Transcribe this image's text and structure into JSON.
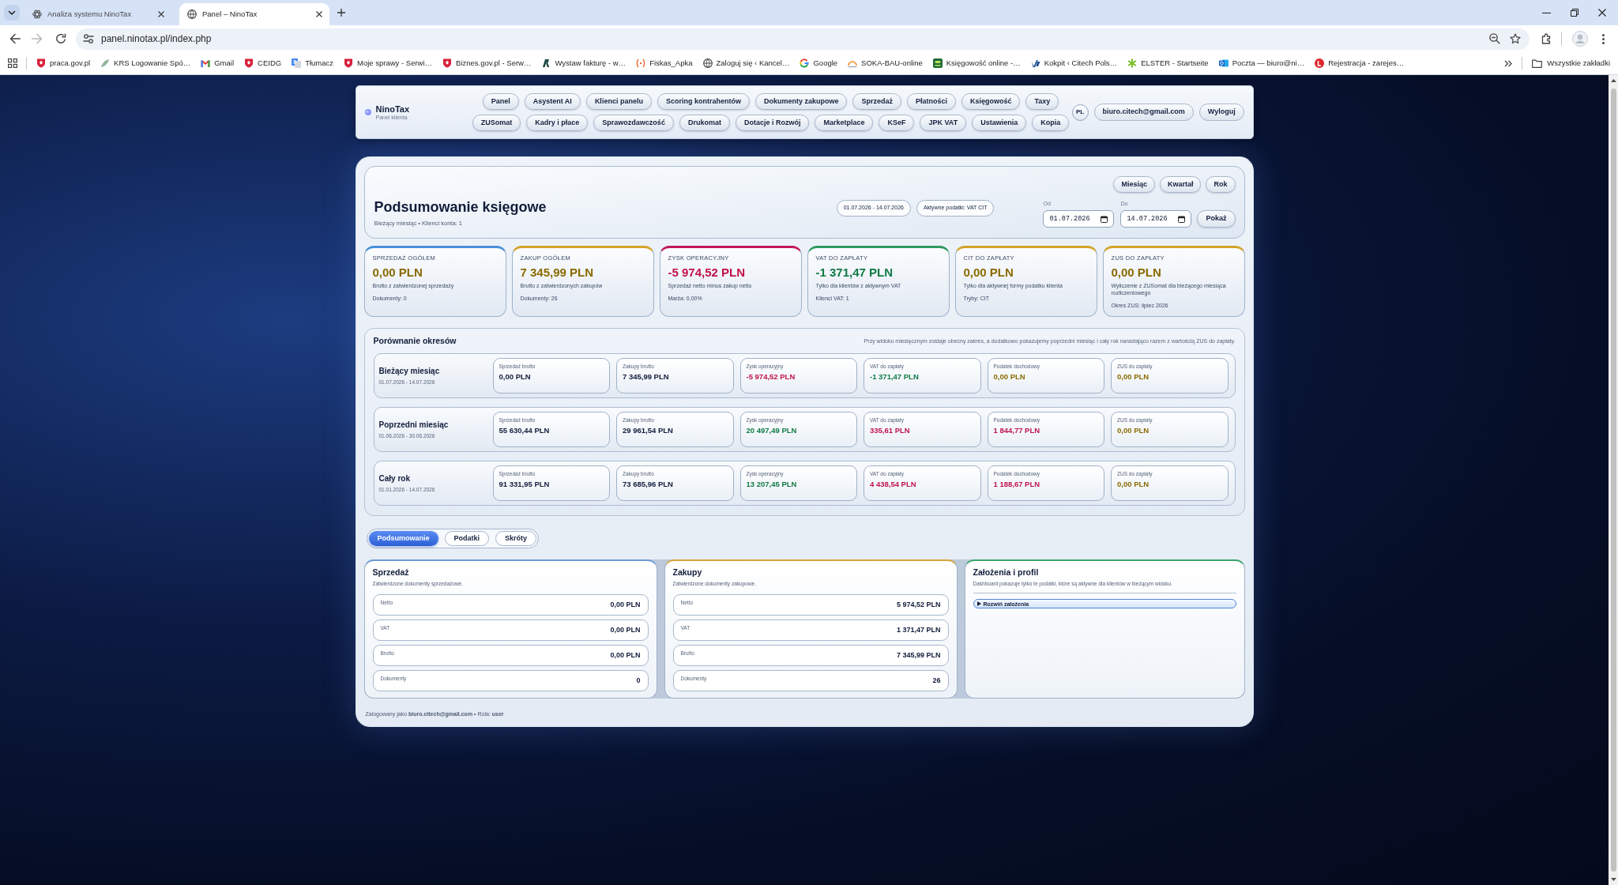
{
  "browser": {
    "tabs": [
      {
        "title": "Analiza systemu NinoTax",
        "selected": false
      },
      {
        "title": "Panel – NinoTax",
        "selected": true
      }
    ],
    "url": "panel.ninotax.pl/index.php",
    "bookmarks": [
      "praca.gov.pl",
      "KRS Logowanie Spó…",
      "Gmail",
      "CEIDG",
      "Tłumacz",
      "Moje sprawy - Serwi…",
      "Biznes.gov.pl - Serw…",
      "Wystaw fakturę - w…",
      "Fiskas_Apka",
      "Zaloguj się ‹ Kancel…",
      "Google",
      "SOKA-BAU-online",
      "Księgowość online -…",
      "Kokpit ‹ Citech Pols…",
      "ELSTER - Startseite",
      "Poczta — biuro@ni…",
      "Rejestracja - zarejes…"
    ],
    "all_bookmarks": "Wszystkie zakładki"
  },
  "header": {
    "brand": "NinoTax",
    "tagline": "Panel klienta",
    "nav": [
      [
        "Panel",
        "Asystent AI",
        "Klienci panelu",
        "Scoring kontrahentów",
        "Dokumenty zakupowe",
        "Sprzedaż",
        "Płatności",
        "Księgowość",
        "Taxy"
      ],
      [
        "ZUSomat",
        "Kadry i płace",
        "Sprawozdawczość",
        "Drukomat",
        "Dotacje i Rozwój",
        "Marketplace",
        "KSeF",
        "JPK VAT",
        "Ustawienia",
        "Kopia"
      ]
    ],
    "language": "PL",
    "account": "biuro.citech@gmail.com",
    "logout": "Wyloguj"
  },
  "summary": {
    "title": "Podsumowanie księgowe",
    "subtitle": "Bieżący miesiąc • Klienci konta: 1",
    "tags": [
      "01.07.2026 - 14.07.2026",
      "Aktywne podatki: VAT CIT"
    ],
    "range_buttons": [
      "Miesiąc",
      "Kwartał",
      "Rok"
    ],
    "date_from": {
      "label": "Od",
      "value": "01.07.2026"
    },
    "date_to": {
      "label": "Do",
      "value": "14.07.2026"
    },
    "submit": "Pokaż"
  },
  "kpis": [
    {
      "label": "SPRZEDAŻ OGÓŁEM",
      "color": "#4a90d9",
      "amount": {
        "text": "0,00 PLN",
        "color": "#8a6a00"
      },
      "description": "Brutto z zatwierdzonej sprzedaży",
      "note": "Dokumenty: 0"
    },
    {
      "label": "ZAKUP OGÓŁEM",
      "color": "#d4a22a",
      "amount": {
        "text": "7 345,99 PLN",
        "color": "#8a6a00"
      },
      "description": "Brutto z zatwierdzonych zakupów",
      "note": "Dokumenty: 26"
    },
    {
      "label": "ZYSK OPERACYJNY",
      "color": "#c2185b",
      "amount": {
        "text": "-5 974,52 PLN",
        "color": "#c0124a"
      },
      "description": "Sprzedaż netto minus zakup netto",
      "note": "Marża: 0,00%"
    },
    {
      "label": "VAT DO ZAPŁATY",
      "color": "#2e9b5f",
      "amount": {
        "text": "-1 371,47 PLN",
        "color": "#107a45"
      },
      "description": "Tylko dla klientów z aktywnym VAT",
      "note": "Klienci VAT: 1"
    },
    {
      "label": "CIT DO ZAPŁATY",
      "color": "#d4a22a",
      "amount": {
        "text": "0,00 PLN",
        "color": "#8a6a00"
      },
      "description": "Tylko dla aktywnej formy podatku klienta",
      "note": "Tryby: CIT"
    },
    {
      "label": "ZUS DO ZAPŁATY",
      "color": "#d4a22a",
      "amount": {
        "text": "0,00 PLN",
        "color": "#8a6a00"
      },
      "description": "Wyliczenie z ZUSomat dla bieżącego miesiąca rozliczeniowego",
      "note": "Okres ZUS: lipiec 2026"
    }
  ],
  "comparison": {
    "title": "Porównanie okresów",
    "note": "Przy widoku miesięcznym zostaje obecny zakres, a dodatkowo pokazujemy poprzedni miesiąc i cały rok narastająco razem z wartością ZUS do zapłaty.",
    "rows": [
      {
        "label": "Bieżący miesiąc",
        "range": "01.07.2026 - 14.07.2026",
        "cells": [
          {
            "label": "Sprzedaż brutto",
            "value": "0,00 PLN",
            "color": "#111c3a"
          },
          {
            "label": "Zakupy brutto",
            "value": "7 345,99 PLN",
            "color": "#111c3a"
          },
          {
            "label": "Zysk operacyjny",
            "value": "-5 974,52 PLN",
            "color": "#c0124a"
          },
          {
            "label": "VAT do zapłaty",
            "value": "-1 371,47 PLN",
            "color": "#107a45"
          },
          {
            "label": "Podatek dochodowy",
            "value": "0,00 PLN",
            "color": "#8a6a00"
          },
          {
            "label": "ZUS do zapłaty",
            "value": "0,00 PLN",
            "color": "#8a6a00"
          }
        ]
      },
      {
        "label": "Poprzedni miesiąc",
        "range": "01.06.2026 - 30.06.2026",
        "cells": [
          {
            "label": "Sprzedaż brutto",
            "value": "55 630,44 PLN",
            "color": "#111c3a"
          },
          {
            "label": "Zakupy brutto",
            "value": "29 961,54 PLN",
            "color": "#111c3a"
          },
          {
            "label": "Zysk operacyjny",
            "value": "20 497,49 PLN",
            "color": "#107a45"
          },
          {
            "label": "VAT do zapłaty",
            "value": "335,61 PLN",
            "color": "#c0124a"
          },
          {
            "label": "Podatek dochodowy",
            "value": "1 844,77 PLN",
            "color": "#c0124a"
          },
          {
            "label": "ZUS do zapłaty",
            "value": "0,00 PLN",
            "color": "#8a6a00"
          }
        ]
      },
      {
        "label": "Cały rok",
        "range": "01.01.2026 - 14.07.2026",
        "cells": [
          {
            "label": "Sprzedaż brutto",
            "value": "91 331,95 PLN",
            "color": "#111c3a"
          },
          {
            "label": "Zakupy brutto",
            "value": "73 685,96 PLN",
            "color": "#111c3a"
          },
          {
            "label": "Zysk operacyjny",
            "value": "13 207,45 PLN",
            "color": "#107a45"
          },
          {
            "label": "VAT do zapłaty",
            "value": "4 438,54 PLN",
            "color": "#c0124a"
          },
          {
            "label": "Podatek dochodowy",
            "value": "1 188,67 PLN",
            "color": "#c0124a"
          },
          {
            "label": "ZUS do zapłaty",
            "value": "0,00 PLN",
            "color": "#8a6a00"
          }
        ]
      }
    ]
  },
  "view_tabs": [
    {
      "label": "Podsumowanie",
      "selected": true
    },
    {
      "label": "Podatki",
      "selected": false
    },
    {
      "label": "Skróty",
      "selected": false
    }
  ],
  "panels": [
    {
      "kind": "totals",
      "title": "Sprzedaż",
      "subtitle": "Zatwierdzone dokumenty sprzedażowe.",
      "color": "#6c9bd6",
      "rows": [
        {
          "label": "Netto",
          "value": "0,00 PLN"
        },
        {
          "label": "VAT",
          "value": "0,00 PLN"
        },
        {
          "label": "Brutto",
          "value": "0,00 PLN"
        },
        {
          "label": "Dokumenty",
          "value": "0"
        }
      ]
    },
    {
      "kind": "totals",
      "title": "Zakupy",
      "subtitle": "Zatwierdzone dokumenty zakupowe.",
      "color": "#d6a53a",
      "rows": [
        {
          "label": "Netto",
          "value": "5 974,52 PLN"
        },
        {
          "label": "VAT",
          "value": "1 371,47 PLN"
        },
        {
          "label": "Brutto",
          "value": "7 345,99 PLN"
        },
        {
          "label": "Dokumenty",
          "value": "26"
        }
      ]
    },
    {
      "kind": "info",
      "title": "Założenia i profil",
      "subtitle": "Dashboard pokazuje tylko te podatki, które są aktywne dla klientów w bieżącym widoku.",
      "color": "#3aa56a",
      "disclosure": {
        "label": "Rozwiń założenia",
        "expanded": false
      }
    }
  ],
  "footer": "Zalogowany jako **biuro.citech@gmail.com** • Rola: **user**"
}
